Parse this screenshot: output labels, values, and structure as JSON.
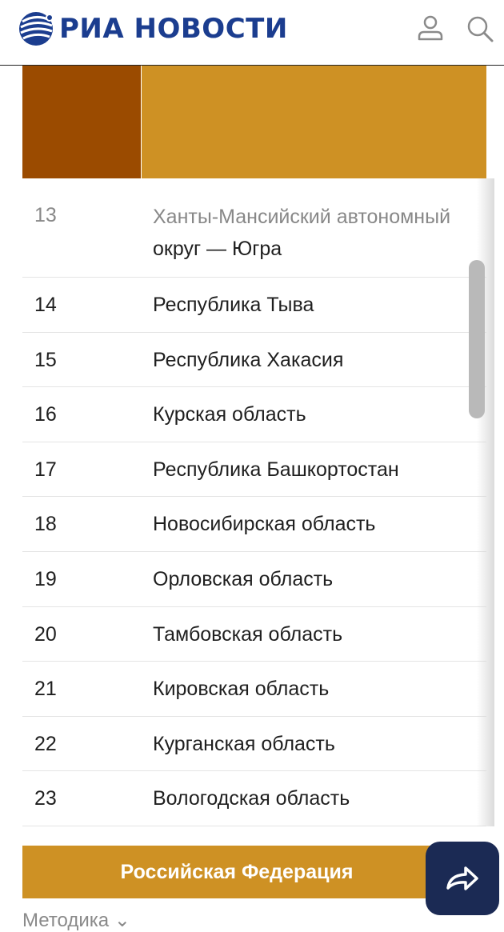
{
  "header": {
    "brand": "РИА НОВОСТИ",
    "icons": {
      "logo": "ria-globe-icon",
      "user": "user-icon",
      "search": "search-icon"
    }
  },
  "colors": {
    "brand_blue": "#1b3d8f",
    "band_dark": "#9b4b00",
    "band_light": "#ce9124",
    "share_button": "#1b2a54"
  },
  "table": {
    "rows": [
      {
        "rank": "13",
        "region_line1": "Ханты-Мансийский автономный",
        "region_line2": "округ — Югра"
      },
      {
        "rank": "14",
        "region": "Республика Тыва"
      },
      {
        "rank": "15",
        "region": "Республика Хакасия"
      },
      {
        "rank": "16",
        "region": "Курская область"
      },
      {
        "rank": "17",
        "region": "Республика Башкортостан"
      },
      {
        "rank": "18",
        "region": "Новосибирская область"
      },
      {
        "rank": "19",
        "region": "Орловская область"
      },
      {
        "rank": "20",
        "region": "Тамбовская область"
      },
      {
        "rank": "21",
        "region": "Кировская область"
      },
      {
        "rank": "22",
        "region": "Курганская область"
      },
      {
        "rank": "23",
        "region": "Вологодская область"
      }
    ]
  },
  "footer": {
    "summary_label": "Российская Федерация",
    "method_link": "Методика ⌄"
  },
  "share": {
    "icon": "share-arrow-icon"
  }
}
